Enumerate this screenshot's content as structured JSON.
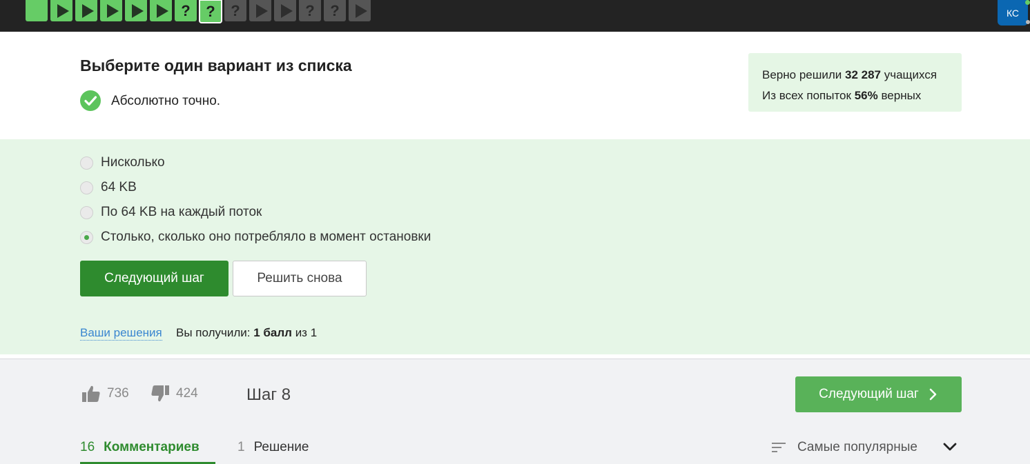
{
  "steps": [
    {
      "state": "green",
      "icon": "blank"
    },
    {
      "state": "green",
      "icon": "play"
    },
    {
      "state": "green",
      "icon": "play"
    },
    {
      "state": "green",
      "icon": "play"
    },
    {
      "state": "green",
      "icon": "play"
    },
    {
      "state": "green",
      "icon": "play"
    },
    {
      "state": "green",
      "icon": "?"
    },
    {
      "state": "green-current",
      "icon": "?"
    },
    {
      "state": "grey",
      "icon": "?"
    },
    {
      "state": "grey",
      "icon": "play"
    },
    {
      "state": "grey",
      "icon": "play"
    },
    {
      "state": "grey",
      "icon": "?"
    },
    {
      "state": "grey",
      "icon": "?"
    },
    {
      "state": "grey",
      "icon": "play"
    }
  ],
  "user": {
    "initials": "КС"
  },
  "quiz": {
    "title": "Выберите один вариант из списка",
    "feedback": "Абсолютно точно.",
    "options": [
      {
        "label": "Нисколько",
        "selected": false
      },
      {
        "label": "64 KB",
        "selected": false
      },
      {
        "label": "По 64 KB на каждый поток",
        "selected": false
      },
      {
        "label": "Столько, сколько оно потребляло в момент остановки",
        "selected": true
      }
    ],
    "next_label": "Следующий шаг",
    "retry_label": "Решить снова",
    "solutions_link": "Ваши решения",
    "score_prefix": "Вы получили:",
    "score_value": "1 балл",
    "score_suffix": "из 1"
  },
  "stats": {
    "solved_prefix": "Верно решили",
    "solved_count": "32 287",
    "solved_suffix": "учащихся",
    "attempts_prefix": "Из всех попыток",
    "attempts_percent": "56%",
    "attempts_suffix": "верных"
  },
  "footer": {
    "likes": "736",
    "dislikes": "424",
    "step_label": "Шаг 8",
    "next_label": "Следующий шаг",
    "comments_count": "16",
    "comments_label": "Комментариев",
    "solutions_count": "1",
    "solutions_label": "Решение",
    "sort_label": "Самые популярные"
  },
  "colors": {
    "accent_green": "#2e8b2e",
    "step_green": "#66cc66",
    "options_bg": "#e6f6e7",
    "avatar_blue": "#0b67b2"
  }
}
